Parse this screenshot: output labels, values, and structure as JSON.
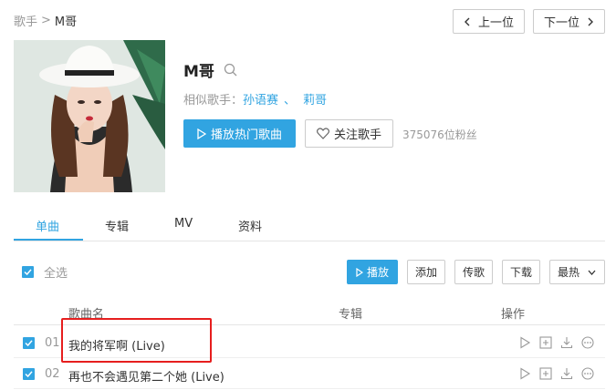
{
  "breadcrumb": {
    "parent": "歌手",
    "separator": ">",
    "current": "M哥"
  },
  "nav": {
    "prev_label": "上一位",
    "next_label": "下一位"
  },
  "artist": {
    "name": "M哥",
    "similar_label": "相似歌手：",
    "similar": [
      "孙语赛",
      "莉哥"
    ],
    "similar_separator": "、",
    "play_hot_label": "播放热门歌曲",
    "follow_label": "关注歌手",
    "fans": "375076位粉丝"
  },
  "tabs": [
    "单曲",
    "专辑",
    "MV",
    "资料"
  ],
  "toolbar": {
    "select_all": "全选",
    "play": "播放",
    "add": "添加",
    "upload": "传歌",
    "download": "下载",
    "sort": "最热"
  },
  "table": {
    "headers": {
      "name": "歌曲名",
      "album": "专辑",
      "ops": "操作"
    },
    "rows": [
      {
        "num": "01",
        "title": "我的将军啊 (Live)"
      },
      {
        "num": "02",
        "title": "再也不会遇见第二个她 (Live)"
      }
    ]
  },
  "colors": {
    "accent": "#31a4e1",
    "highlight": "#e61e1e"
  },
  "icons": {
    "search": "search-icon",
    "play": "play-icon",
    "heart": "heart-icon",
    "chevron_left": "chevron-left-icon",
    "chevron_right": "chevron-right-icon",
    "chevron_down": "chevron-down-icon",
    "add": "add-icon",
    "download": "download-icon",
    "more": "more-icon",
    "check": "check-icon"
  }
}
